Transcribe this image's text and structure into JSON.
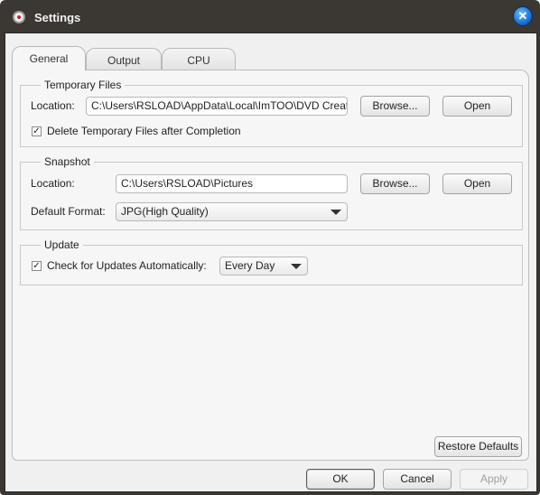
{
  "window": {
    "title": "Settings"
  },
  "tabs": [
    {
      "label": "General",
      "active": true
    },
    {
      "label": "Output",
      "active": false
    },
    {
      "label": "CPU",
      "active": false
    }
  ],
  "temp": {
    "title": "Temporary Files",
    "location_label": "Location:",
    "location_value": "C:\\Users\\RSLOAD\\AppData\\Local\\ImTOO\\DVD Creat",
    "browse": "Browse...",
    "open": "Open",
    "delete_label": "Delete Temporary Files after Completion",
    "delete_checked": true
  },
  "snapshot": {
    "title": "Snapshot",
    "location_label": "Location:",
    "location_value": "C:\\Users\\RSLOAD\\Pictures",
    "browse": "Browse...",
    "open": "Open",
    "format_label": "Default Format:",
    "format_value": "JPG(High Quality)"
  },
  "update": {
    "title": "Update",
    "check_label": "Check for Updates Automatically:",
    "check_checked": true,
    "frequency_value": "Every Day"
  },
  "buttons": {
    "restore": "Restore Defaults",
    "ok": "OK",
    "cancel": "Cancel",
    "apply": "Apply"
  },
  "icons": {
    "check": "✓",
    "close": "✕"
  }
}
